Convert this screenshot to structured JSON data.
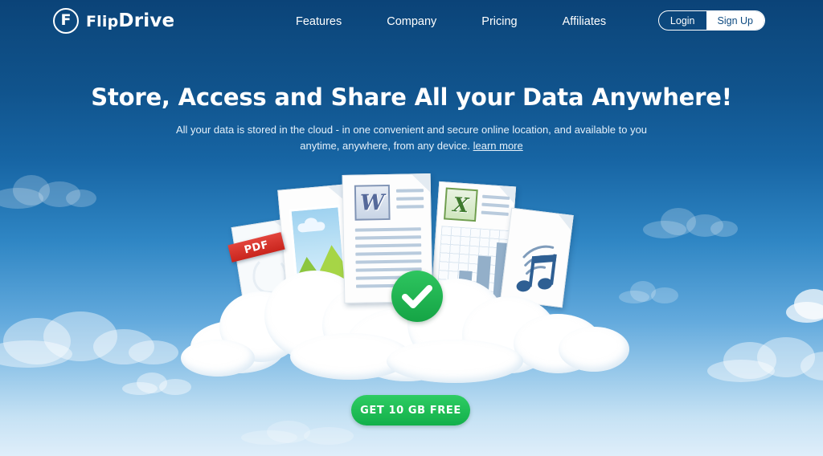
{
  "brand": {
    "name": "FlipDrive",
    "name_part1": "Flip",
    "name_part2": "Drive",
    "mark_letter": "F",
    "logo_icon": "circled-f-logo-icon"
  },
  "nav": {
    "items": [
      {
        "label": "Features"
      },
      {
        "label": "Company"
      },
      {
        "label": "Pricing"
      },
      {
        "label": "Affiliates"
      }
    ]
  },
  "auth": {
    "login_label": "Login",
    "signup_label": "Sign Up"
  },
  "hero": {
    "headline": "Store, Access and Share All your Data Anywhere!",
    "subcopy": "All your data is stored in the cloud - in one convenient and secure online location, and available to you anytime, anywhere, from any device.",
    "learn_more_label": "learn more",
    "cta_label": "GET 10 GB FREE"
  },
  "illustration": {
    "documents": [
      {
        "type": "pdf-document",
        "badge": "PDF",
        "icon": "pdf-icon"
      },
      {
        "type": "image-document",
        "icon": "photo-icon"
      },
      {
        "type": "word-document",
        "icon": "word-w-icon",
        "glyph": "W"
      },
      {
        "type": "excel-document",
        "icon": "excel-x-icon",
        "glyph": "X"
      },
      {
        "type": "audio-document",
        "icon": "music-note-icon"
      }
    ],
    "check_icon": "green-check-icon",
    "cloud": "cloud-graphic"
  },
  "colors": {
    "brand_dark_blue": "#0b4378",
    "sky_light": "#dfeefa",
    "cta_green": "#12b04a",
    "pdf_red": "#c9251d",
    "word_blue": "#55699a",
    "excel_green": "#3f7a2e",
    "check_green": "#15a445",
    "white": "#ffffff"
  }
}
